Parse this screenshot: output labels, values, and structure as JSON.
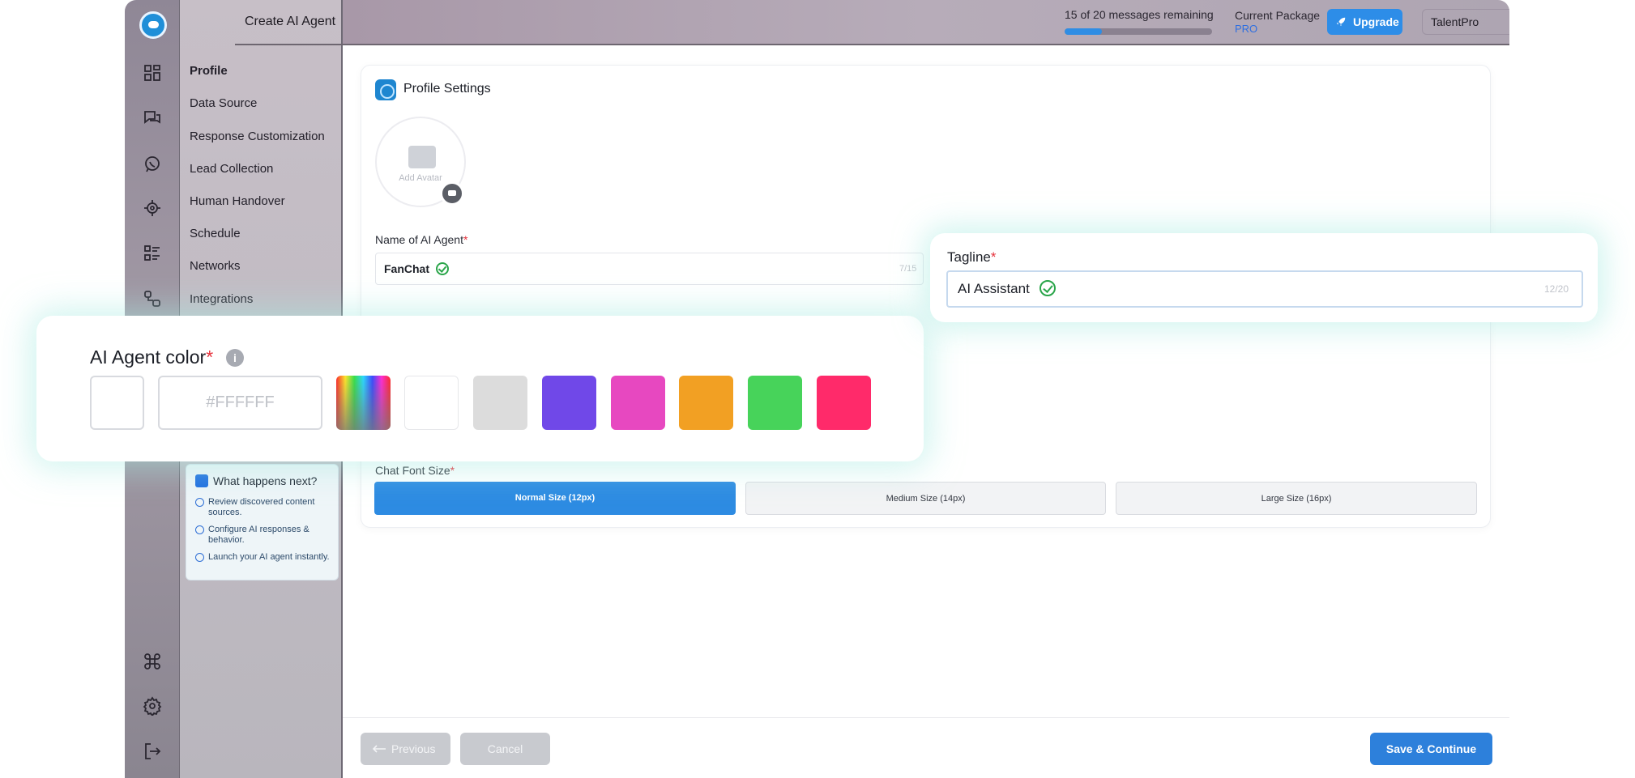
{
  "app": {
    "page_title": "Create AI Agent",
    "sidebar_items": [
      {
        "label": "Profile",
        "active": true
      },
      {
        "label": "Data Source"
      },
      {
        "label": "Response Customization"
      },
      {
        "label": "Lead Collection"
      },
      {
        "label": "Human Handover"
      },
      {
        "label": "Schedule"
      },
      {
        "label": "Networks"
      },
      {
        "label": "Integrations"
      }
    ],
    "rail_icons": [
      "dashboard-icon",
      "chat-icon",
      "whatsapp-icon",
      "target-icon",
      "list-icon",
      "workflow-icon",
      "command-icon",
      "gear-icon",
      "logout-icon"
    ],
    "next_steps": {
      "title": "What happens next?",
      "items": [
        "Review discovered content sources.",
        "Configure AI responses & behavior.",
        "Launch your AI agent instantly."
      ]
    }
  },
  "topbar": {
    "messages_text": "15 of 20 messages remaining",
    "messages_used_fraction": 0.25,
    "package_label": "Current Package",
    "package_value": "PRO",
    "upgrade_label": "Upgrade",
    "company": "TalentPro"
  },
  "profile": {
    "section_title": "Profile Settings",
    "avatar_label": "Add Avatar",
    "name_label": "Name of AI Agent",
    "name_value": "FanChat",
    "name_counter": "7/15",
    "font_size_label": "Chat Font Size",
    "font_sizes": [
      "Normal Size (12px)",
      "Medium Size (14px)",
      "Large Size (16px)"
    ],
    "font_size_selected": "Normal Size (12px)"
  },
  "color_panel": {
    "title": "AI Agent color",
    "hex_placeholder": "#FFFFFF",
    "swatches": [
      "#ffffff",
      "#dcdcdc",
      "#7048e8",
      "#e748c0",
      "#f2a023",
      "#47d35a",
      "#ff2a6a"
    ],
    "colors": {
      "accent": "#2d80db",
      "required": "#e5303a"
    }
  },
  "tagline_panel": {
    "label": "Tagline",
    "value": "AI Assistant",
    "counter": "12/20"
  },
  "footer": {
    "previous_label": "Previous",
    "cancel_label": "Cancel",
    "save_label": "Save & Continue"
  }
}
